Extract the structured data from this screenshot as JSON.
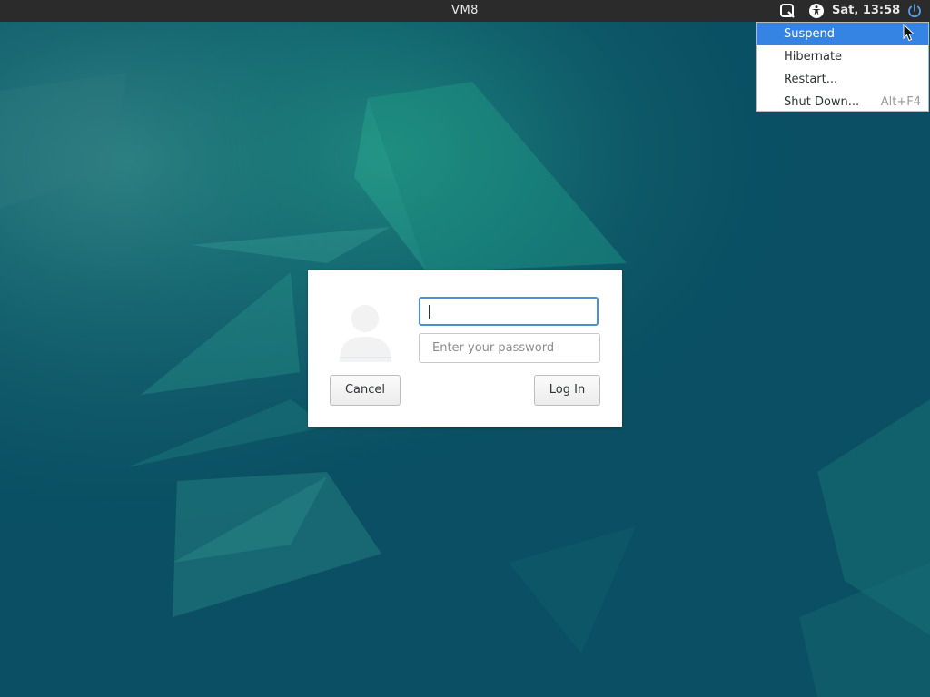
{
  "topbar": {
    "host_name": "VM8",
    "clock": "Sat, 13:58",
    "icons": [
      "keyboard-indicator-icon",
      "accessibility-icon",
      "power-icon"
    ]
  },
  "power_menu": {
    "items": [
      {
        "label": "Suspend",
        "accel": "",
        "active": true
      },
      {
        "label": "Hibernate",
        "accel": ""
      },
      {
        "label": "Restart...",
        "accel": ""
      },
      {
        "label": "Shut Down...",
        "accel": "Alt+F4"
      }
    ],
    "highlight_color": "#3584e4"
  },
  "login": {
    "username_value": "",
    "password_placeholder": "Enter your password",
    "cancel_label": "Cancel",
    "login_label": "Log In",
    "focus_color": "#4a90d9"
  },
  "theme": {
    "background": "#0b5468",
    "topbar": "#2b2b2b"
  }
}
